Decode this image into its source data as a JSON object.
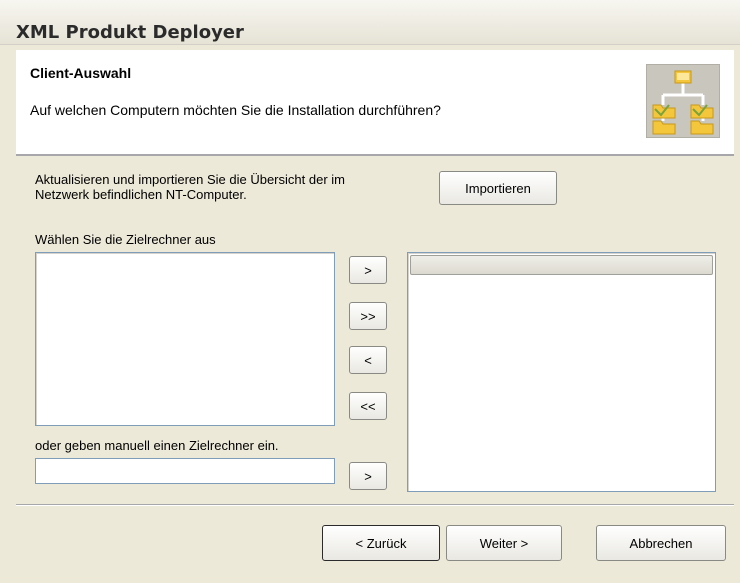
{
  "window": {
    "title": "XML Produkt Deployer"
  },
  "header": {
    "title": "Client-Auswahl",
    "subtitle": "Auf welchen Computern möchten Sie die Installation durchführen?"
  },
  "import_section": {
    "description_line1": "Aktualisieren und importieren Sie die Übersicht der im",
    "description_line2": "Netzwerk befindlichen NT-Computer.",
    "import_button": "Importieren"
  },
  "selection": {
    "available_label": "Wählen Sie die Zielrechner aus",
    "manual_label": "oder geben manuell einen Zielrechner ein.",
    "manual_value": "",
    "add_button": ">",
    "add_all_button": ">>",
    "remove_button": "<",
    "remove_all_button": "<<",
    "manual_add_button": ">"
  },
  "footer": {
    "back_button": "< Zurück",
    "next_button": "Weiter >",
    "cancel_button": "Abbrechen"
  },
  "icons": {
    "wizard_icon": "network-computers-icon"
  }
}
